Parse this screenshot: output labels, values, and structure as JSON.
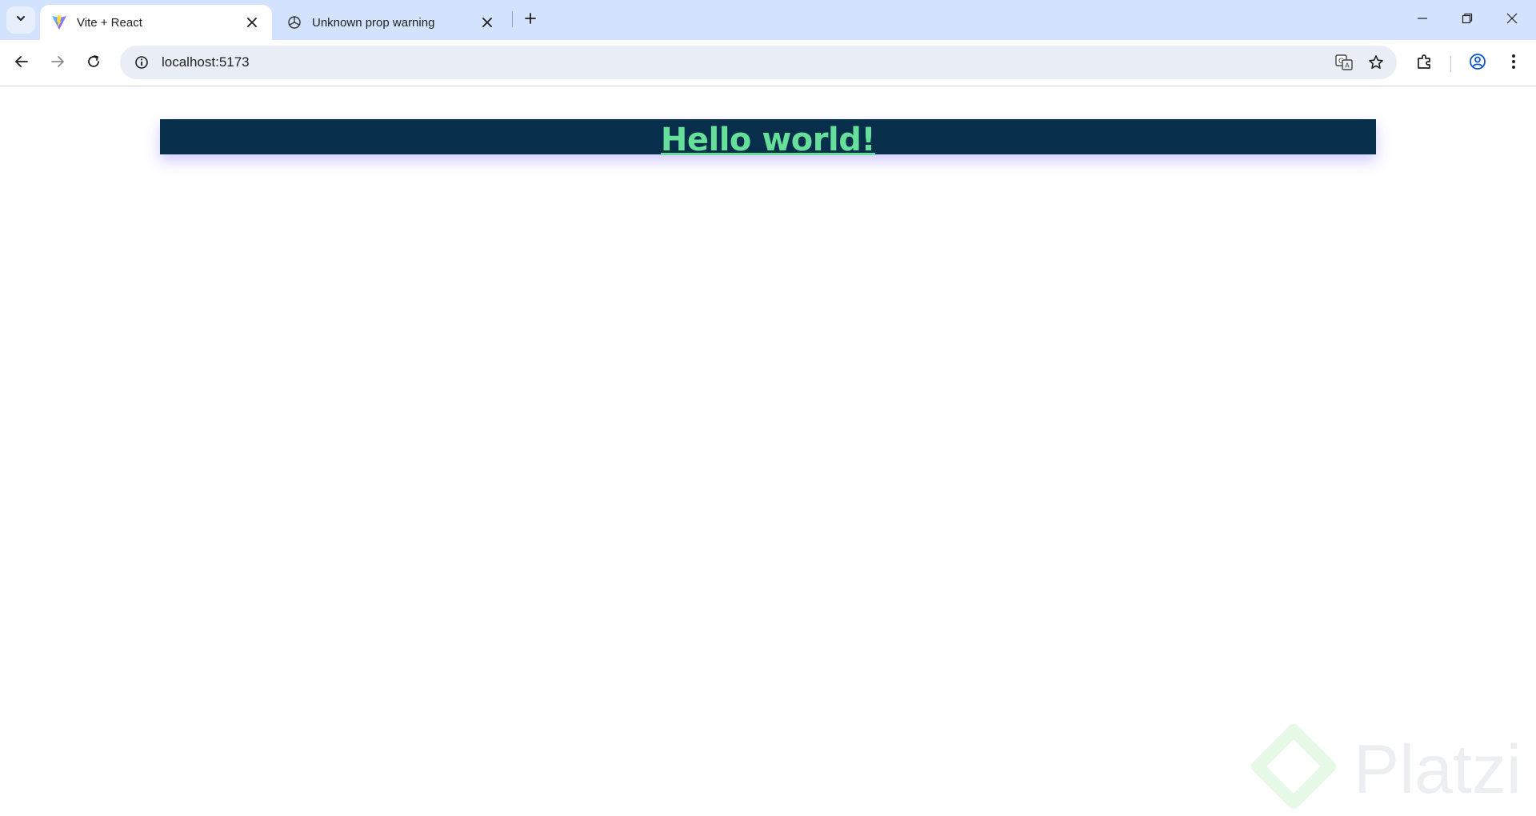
{
  "browser": {
    "tabs": [
      {
        "title": "Vite + React",
        "favicon": "vite-logo-icon",
        "active": true
      },
      {
        "title": "Unknown prop warning",
        "favicon": "openai-logo-icon",
        "active": false
      }
    ],
    "url": "localhost:5173"
  },
  "page": {
    "heading": "Hello world!",
    "heading_color": "#66df9a",
    "bar_color": "#072e4a"
  },
  "watermark": {
    "text": "Platzi"
  },
  "colors": {
    "tabstrip": "#d3e3fd",
    "omnibox": "#e9eef6"
  }
}
